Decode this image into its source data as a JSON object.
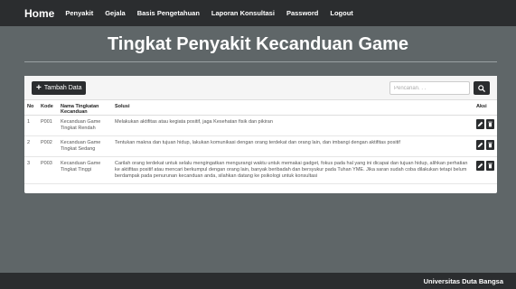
{
  "nav": {
    "brand": "Home",
    "items": [
      "Penyakit",
      "Gejala",
      "Basis Pengetahuan",
      "Laporan Konsultasi",
      "Password",
      "Logout"
    ]
  },
  "page": {
    "title": "Tingkat Penyakit Kecanduan Game"
  },
  "toolbar": {
    "add_label": "Tambah Data",
    "add_icon": "plus-icon",
    "search_placeholder": "Pencarian. . .",
    "search_icon": "search-icon"
  },
  "table": {
    "headers": [
      "No",
      "Kode",
      "Nama Tingkatan Kecanduan",
      "Solusi",
      "Aksi"
    ],
    "rows": [
      {
        "no": "1",
        "kode": "P001",
        "nama": "Kecanduan Game Tingkat Rendah",
        "solusi": "Melakukan aktifitas atau kegiata positif, jaga Kesehatan fisik dan pikiran"
      },
      {
        "no": "2",
        "kode": "P002",
        "nama": "Kecanduan Game Tingkat Sedang",
        "solusi": "Tentukan makna dan tujuan hidup, lakukan komunikasi dengan orang terdekat dan orang lain, dan imbangi dengan aktifitas positif"
      },
      {
        "no": "3",
        "kode": "P003",
        "nama": "Kecanduan Game Tingkat Tinggi",
        "solusi": "Carilah orang terdekat untuk selalu mengingatkan mengurangi waktu untuk memakai gadget, fokus pada hal yang ini dicapai dan tujuan hidup, alihkan perhatian ke aktifitas positif atau mencari berkumpul dengan orang lain, banyak beribadah dan bersyukur pada Tuhan YME. Jika saran sudah coba dilakukan tetapi belum berdampak pada penurunan kecanduan anda, silahkan datang ke psikologi untuk konsultasi"
      }
    ],
    "action_icons": [
      "pencil-icon",
      "trash-icon"
    ]
  },
  "footer": {
    "text": "Universitas Duta Bangsa"
  },
  "colors": {
    "dark": "#2b2d2f",
    "background": "#5f6668",
    "panel": "#ffffff"
  }
}
